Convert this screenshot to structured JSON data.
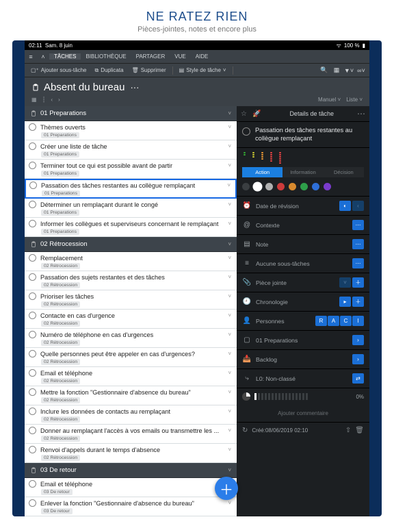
{
  "promo": {
    "title": "NE RATEZ RIEN",
    "subtitle": "Pièces-jointes, notes et encore plus"
  },
  "statusbar": {
    "time": "02:11",
    "date": "Sam. 8 juin",
    "battery": "100 %"
  },
  "menubar": {
    "items": [
      "TÂCHES",
      "BIBLIOTHÈQUE",
      "PARTAGER",
      "VUE",
      "AIDE"
    ],
    "active_index": 0
  },
  "toolbar": {
    "add_subtask": "Ajouter sous-tâche",
    "duplicate": "Duplicata",
    "delete": "Supprimer",
    "task_style": "Style de tâche"
  },
  "document": {
    "title": "Absent du bureau",
    "ellipsis": "···"
  },
  "subhead": {
    "sort_label": "Manuel",
    "view_label": "Liste"
  },
  "groups": [
    {
      "name": "01 Preparations",
      "tasks": [
        {
          "title": "Thèmes ouverts",
          "tag": "01 Preparations"
        },
        {
          "title": "Créer une liste de tâche",
          "tag": "01 Preparations"
        },
        {
          "title": "Terminer tout ce qui est possible avant de partir",
          "tag": "01 Preparations"
        },
        {
          "title": "Passation des tâches restantes au collègue remplaçant",
          "tag": "01 Preparations",
          "selected": true
        },
        {
          "title": "Déterminer un remplaçant durant le congé",
          "tag": "01 Preparations"
        },
        {
          "title": "Informer les collègues et superviseurs concernant le remplaçant",
          "tag": "01 Preparations"
        }
      ]
    },
    {
      "name": "02 Rétrocession",
      "tasks": [
        {
          "title": "Remplacement",
          "tag": "02 Rétrocession"
        },
        {
          "title": "Passation des sujets restantes et des tâches",
          "tag": "02 Rétrocession"
        },
        {
          "title": "Prioriser les tâches",
          "tag": "02 Rétrocession"
        },
        {
          "title": "Contacte en cas d'urgence",
          "tag": "02 Rétrocession"
        },
        {
          "title": "Numéro de téléphone en cas d'urgences",
          "tag": "02 Rétrocession"
        },
        {
          "title": "Quelle personnes peut être appeler en cas d'urgences?",
          "tag": "02 Rétrocession"
        },
        {
          "title": "Email et téléphone",
          "tag": "02 Rétrocession"
        },
        {
          "title": "Mettre la fonction \"Gestionnaire d'absence du bureau\"",
          "tag": "02 Rétrocession"
        },
        {
          "title": "Inclure les données de contacts au remplaçant",
          "tag": "02 Rétrocession"
        },
        {
          "title": "Donner au remplaçant l'accès à vos emails ou transmettre les ...",
          "tag": "02 Rétrocession"
        },
        {
          "title": "Renvoi d'appels durant le temps d'absence",
          "tag": "02 Rétrocession"
        }
      ]
    },
    {
      "name": "03 De retour",
      "tasks": [
        {
          "title": "Email et téléphone",
          "tag": "03 De retour"
        },
        {
          "title": "Enlever la fonction \"Gestionnaire d'absence du bureau\"",
          "tag": "03 De retour"
        }
      ]
    }
  ],
  "details": {
    "header": "Details de tâche",
    "task_title": "Passation des tâches restantes au collègue remplaçant",
    "tabs": [
      "Action",
      "Information",
      "Décision"
    ],
    "active_tab": 0,
    "swatches": [
      "#3a3e41",
      "#ffffff",
      "#b0b0b0",
      "#cc3b3b",
      "#d88a2e",
      "#2e9e4a",
      "#2e6fd8",
      "#7a3bcc"
    ],
    "selected_swatch": 1,
    "rows": {
      "revision": "Date de révision",
      "context": "Contexte",
      "note": "Note",
      "subtasks": "Aucune sous-tâches",
      "attachment": "Pièce jointe",
      "chronology": "Chronologie",
      "people": "Personnes",
      "raci": [
        "R",
        "A",
        "C",
        "I"
      ],
      "project": "01 Preparations",
      "backlog": "Backlog",
      "level": "L0: Non-classé"
    },
    "progress_pct": "0%",
    "comment_placeholder": "Ajouter commentaire",
    "created": "Créé:08/06/2019 02:10"
  }
}
